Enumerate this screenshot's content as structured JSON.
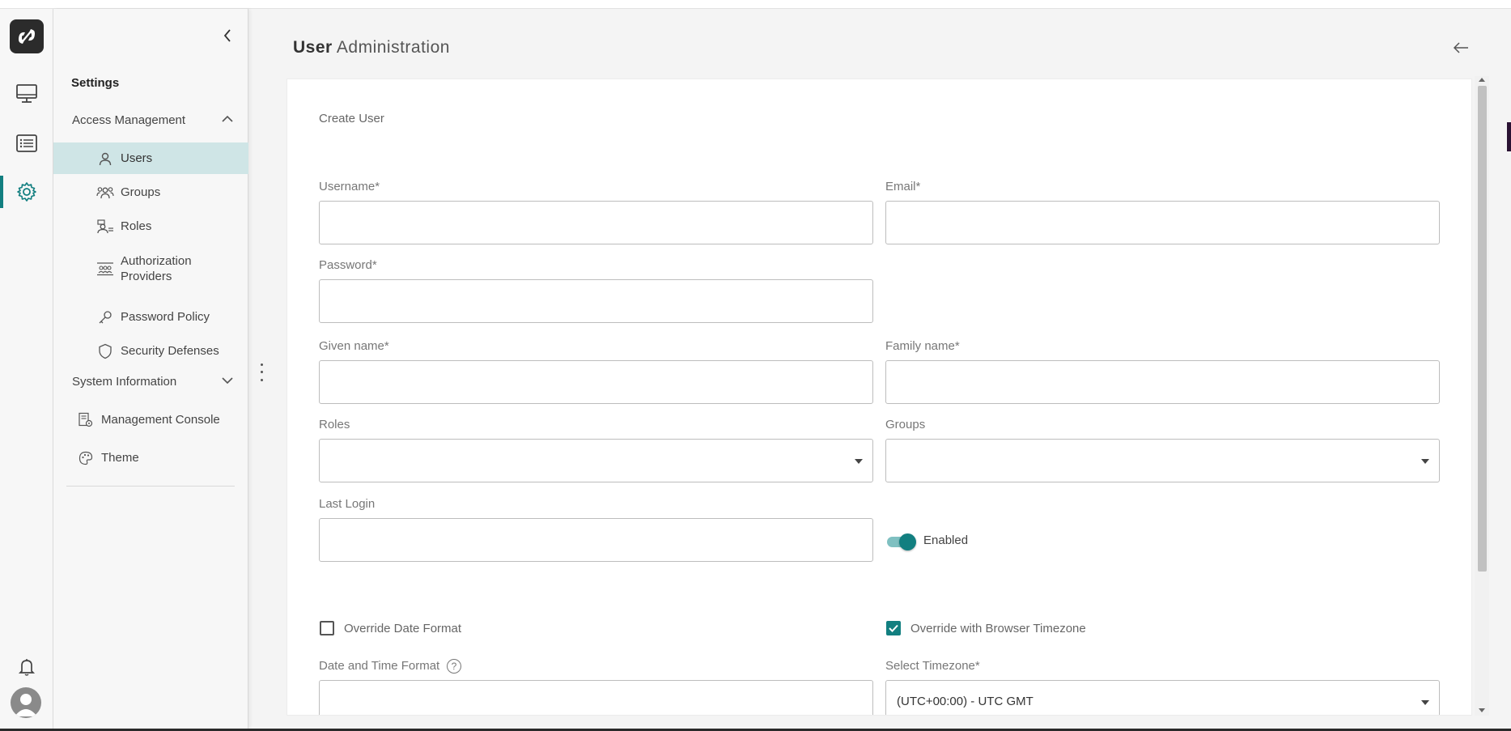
{
  "header": {
    "title_bold": "User",
    "title_rest": "Administration"
  },
  "sidebar": {
    "title": "Settings",
    "access_management": "Access Management",
    "items": [
      {
        "label": "Users",
        "icon": "user-icon"
      },
      {
        "label": "Groups",
        "icon": "groups-icon"
      },
      {
        "label": "Roles",
        "icon": "roles-icon"
      },
      {
        "label": "Authorization Providers",
        "icon": "authorization-providers-icon"
      },
      {
        "label": "Password Policy",
        "icon": "key-icon"
      },
      {
        "label": "Security Defenses",
        "icon": "shield-icon"
      }
    ],
    "system_information": "System Information",
    "management_console": "Management Console",
    "theme": "Theme"
  },
  "form": {
    "subtitle": "Create User",
    "username_label": "Username*",
    "email_label": "Email*",
    "password_label": "Password*",
    "given_name_label": "Given name*",
    "family_name_label": "Family name*",
    "roles_label": "Roles",
    "groups_label": "Groups",
    "last_login_label": "Last Login",
    "enabled_label": "Enabled",
    "enabled": true,
    "override_date_format_label": "Override Date Format",
    "override_date_format": false,
    "override_browser_tz_label": "Override with Browser Timezone",
    "override_browser_tz": true,
    "date_time_format_label": "Date and Time Format",
    "select_timezone_label": "Select Timezone*",
    "timezone_value": "(UTC+00:00) - UTC GMT"
  },
  "colors": {
    "accent": "#127f80",
    "selected_bg": "#cfe5e6"
  }
}
